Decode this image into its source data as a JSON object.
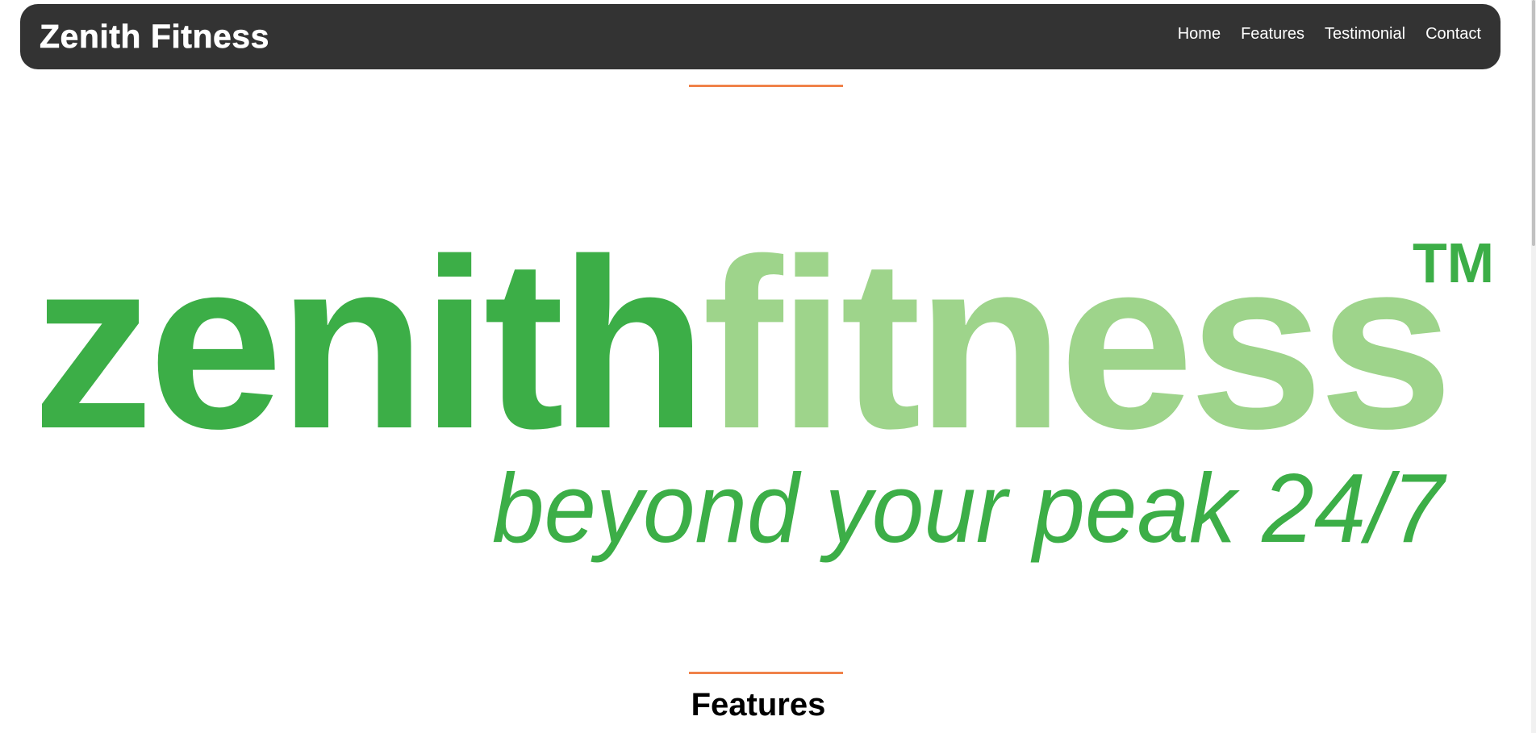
{
  "navbar": {
    "brand": "Zenith Fitness",
    "links": [
      "Home",
      "Features",
      "Testimonial",
      "Contact"
    ]
  },
  "hero": {
    "logo_word_dark": "zenith",
    "logo_word_light": "fitness",
    "logo_trademark": "TM",
    "tagline": "beyond your peak 24/7"
  },
  "features": {
    "heading": "Features"
  },
  "colors": {
    "navbar_bg": "#333333",
    "accent": "#f0824a",
    "logo_dark_green": "#3cae47",
    "logo_light_green": "#9ed48b"
  }
}
